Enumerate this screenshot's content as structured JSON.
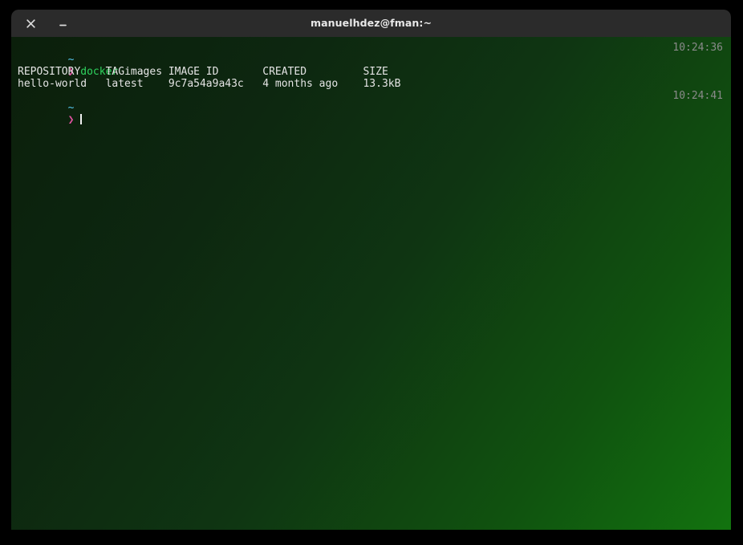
{
  "window": {
    "title": "manuelhdez@fman:~",
    "close_label": "×",
    "minimize_label": "–",
    "close_name": "close-icon",
    "minimize_name": "minimize-icon"
  },
  "theme": {
    "titlebar_bg": "#2b2b2b",
    "title_fg": "#e8e8e8",
    "desktop_bg": "#000000",
    "bg_gradient_start": "#0b1f0b",
    "bg_gradient_end": "#12730f",
    "tilde_color": "#56c8f0",
    "prompt_color": "#e052a0",
    "command_color": "#2fd35e",
    "output_color": "#e4e4e4",
    "timestamp_color": "#8a8a8a",
    "cursor_color": "#f0f0f0"
  },
  "terminal": {
    "blocks": [
      {
        "cwd": "~",
        "prompt_symbol": "❯",
        "command_name": "docker",
        "command_args": " images",
        "timestamp": "10:24:36"
      },
      {
        "cwd": "~",
        "prompt_symbol": "❯",
        "command_name": "",
        "command_args": "",
        "timestamp": "10:24:41"
      }
    ],
    "output_table": {
      "headers": [
        "REPOSITORY",
        "TAG",
        "IMAGE ID",
        "CREATED",
        "SIZE"
      ],
      "header_line": "REPOSITORY    TAG       IMAGE ID       CREATED         SIZE",
      "rows": [
        {
          "repository": "hello-world",
          "tag": "latest",
          "image_id": "9c7a54a9a43c",
          "created": "4 months ago",
          "size": "13.3kB",
          "line": "hello-world   latest    9c7a54a9a43c   4 months ago    13.3kB"
        }
      ]
    }
  }
}
